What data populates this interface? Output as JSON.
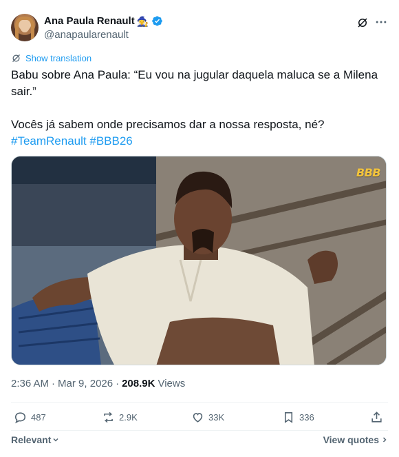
{
  "author": {
    "display_name": "Ana Paula Renault",
    "name_emoji": "🧙‍♀️",
    "handle": "@anapaularenault",
    "verified": true
  },
  "header_icons": {
    "grok": "grok-icon",
    "more": "more-icon"
  },
  "translate": {
    "label": "Show translation",
    "icon": "translate-icon"
  },
  "tweet": {
    "line1": "Babu sobre Ana Paula: “Eu vou na jugular daquela maluca se a Milena sair.”",
    "line2": "Vocês já sabem onde precisamos dar a nossa resposta, né?",
    "hashtag1": "#TeamRenault",
    "hashtag2": "#BBB26"
  },
  "media": {
    "logo_text": "BBB"
  },
  "meta": {
    "time": "2:36 AM",
    "separator": "·",
    "date": "Mar 9, 2026",
    "views_count": "208.9K",
    "views_label": "Views"
  },
  "actions": {
    "replies": "487",
    "reposts": "2.9K",
    "likes": "33K",
    "bookmarks": "336"
  },
  "bottom": {
    "sort_label": "Relevant",
    "view_quotes_label": "View quotes"
  },
  "colors": {
    "accent": "#1d9bf0",
    "text": "#0f1419",
    "secondary": "#536471",
    "border": "#eff3f4"
  }
}
